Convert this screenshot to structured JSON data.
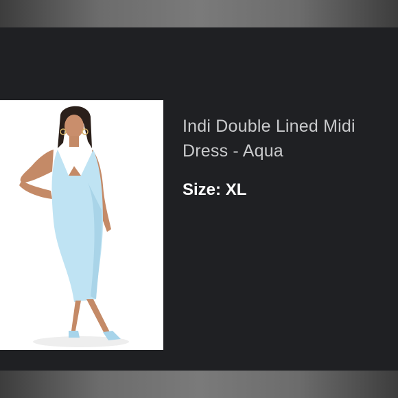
{
  "product": {
    "title": "Indi Double Lined Midi Dress - Aqua",
    "size_label": "Size:",
    "size_value": "XL",
    "image_icon": "product-photo-model-in-aqua-dress"
  },
  "colors": {
    "background": "#1f2023",
    "frame_bar": "#6c6c6c",
    "title_text": "#c9cacc",
    "size_text": "#ffffff",
    "dress": "#bfe3f3",
    "photo_background": "#ffffff"
  }
}
